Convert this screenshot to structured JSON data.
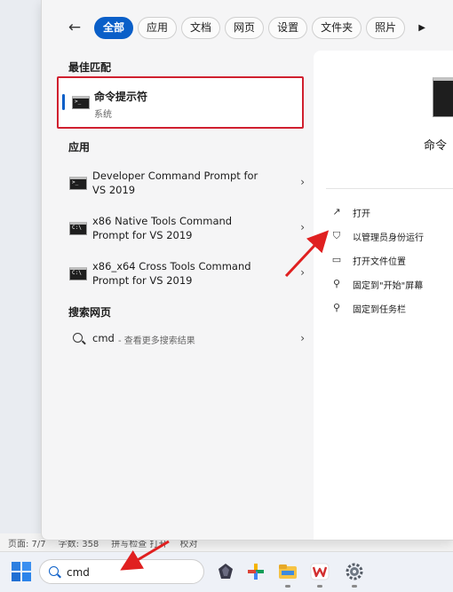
{
  "status_bar": {
    "page": "页面: 7/7",
    "words": "字数: 358",
    "ime": "拼写检查 打开",
    "mode": "校对"
  },
  "filter_bar": {
    "back_icon": "back-arrow-icon",
    "tabs": [
      {
        "label": "全部",
        "active": true
      },
      {
        "label": "应用",
        "active": false
      },
      {
        "label": "文档",
        "active": false
      },
      {
        "label": "网页",
        "active": false
      },
      {
        "label": "设置",
        "active": false
      },
      {
        "label": "文件夹",
        "active": false
      },
      {
        "label": "照片",
        "active": false
      }
    ],
    "more_icon": "▶"
  },
  "sections": {
    "best_match": "最佳匹配",
    "apps": "应用",
    "web": "搜索网页"
  },
  "best_match": {
    "title": "命令提示符",
    "subtitle": "系统"
  },
  "apps": [
    {
      "label_line1": "Developer Command Prompt for",
      "label_line2": "VS 2019"
    },
    {
      "label_line1": "x86 Native Tools Command",
      "label_line2": "Prompt for VS 2019"
    },
    {
      "label_line1": "x86_x64 Cross Tools Command",
      "label_line2": "Prompt for VS 2019"
    }
  ],
  "web_search": {
    "query": "cmd",
    "hint": "- 查看更多搜索结果"
  },
  "detail": {
    "app_name": "命令",
    "actions": [
      {
        "label": "打开",
        "icon": "↗"
      },
      {
        "label": "以管理员身份运行",
        "icon": "⛉"
      },
      {
        "label": "打开文件位置",
        "icon": "▭"
      },
      {
        "label": "固定到\"开始\"屏幕",
        "icon": "⚲"
      },
      {
        "label": "固定到任务栏",
        "icon": "⚲"
      }
    ]
  },
  "taskbar": {
    "search_value": "cmd",
    "apps": [
      "obsidian-icon",
      "pinwheel-icon",
      "file-explorer-icon",
      "wps-icon",
      "settings-gear-icon"
    ]
  },
  "colors": {
    "accent": "#0a5fc8",
    "highlight_border": "#d0202f",
    "annotation_arrow": "#e02020"
  }
}
